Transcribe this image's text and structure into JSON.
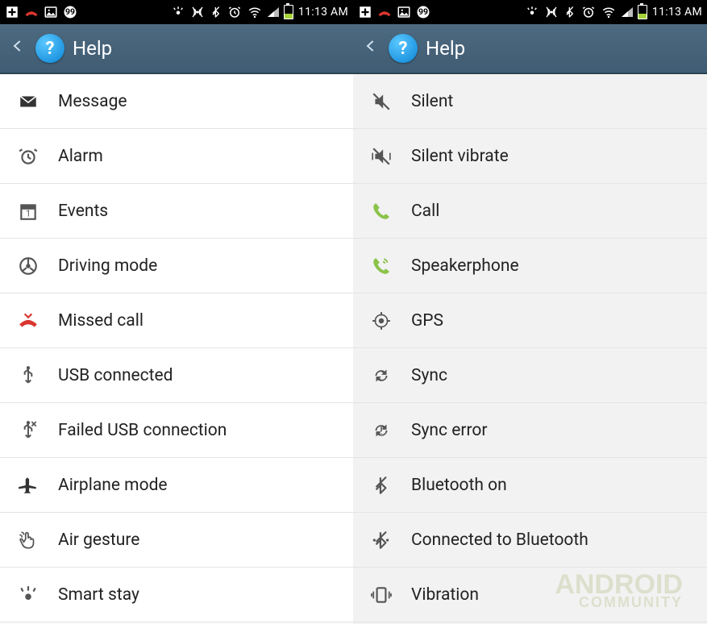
{
  "status": {
    "time": "11:13 AM"
  },
  "appbar": {
    "title": "Help"
  },
  "left": {
    "items": [
      {
        "icon": "message",
        "label": "Message"
      },
      {
        "icon": "alarm",
        "label": "Alarm"
      },
      {
        "icon": "events",
        "label": "Events"
      },
      {
        "icon": "driving",
        "label": "Driving mode"
      },
      {
        "icon": "missed-call",
        "label": "Missed call"
      },
      {
        "icon": "usb",
        "label": "USB connected"
      },
      {
        "icon": "usb-fail",
        "label": "Failed USB connection"
      },
      {
        "icon": "airplane",
        "label": "Airplane mode"
      },
      {
        "icon": "air-gesture",
        "label": "Air gesture"
      },
      {
        "icon": "smart-stay",
        "label": "Smart stay"
      }
    ]
  },
  "right": {
    "items": [
      {
        "icon": "silent",
        "label": "Silent"
      },
      {
        "icon": "silent-vibrate",
        "label": "Silent vibrate"
      },
      {
        "icon": "call",
        "label": "Call"
      },
      {
        "icon": "speakerphone",
        "label": "Speakerphone"
      },
      {
        "icon": "gps",
        "label": "GPS"
      },
      {
        "icon": "sync",
        "label": "Sync"
      },
      {
        "icon": "sync-error",
        "label": "Sync error"
      },
      {
        "icon": "bluetooth",
        "label": "Bluetooth on"
      },
      {
        "icon": "bluetooth-connected",
        "label": "Connected to Bluetooth"
      },
      {
        "icon": "vibration",
        "label": "Vibration"
      }
    ]
  },
  "watermark": {
    "line1": "ANDROID",
    "line2": "COMMUNITY"
  },
  "colors": {
    "appbar": "#3f5c73",
    "accent_green": "#8bc34a",
    "missed_red": "#d9362f"
  }
}
